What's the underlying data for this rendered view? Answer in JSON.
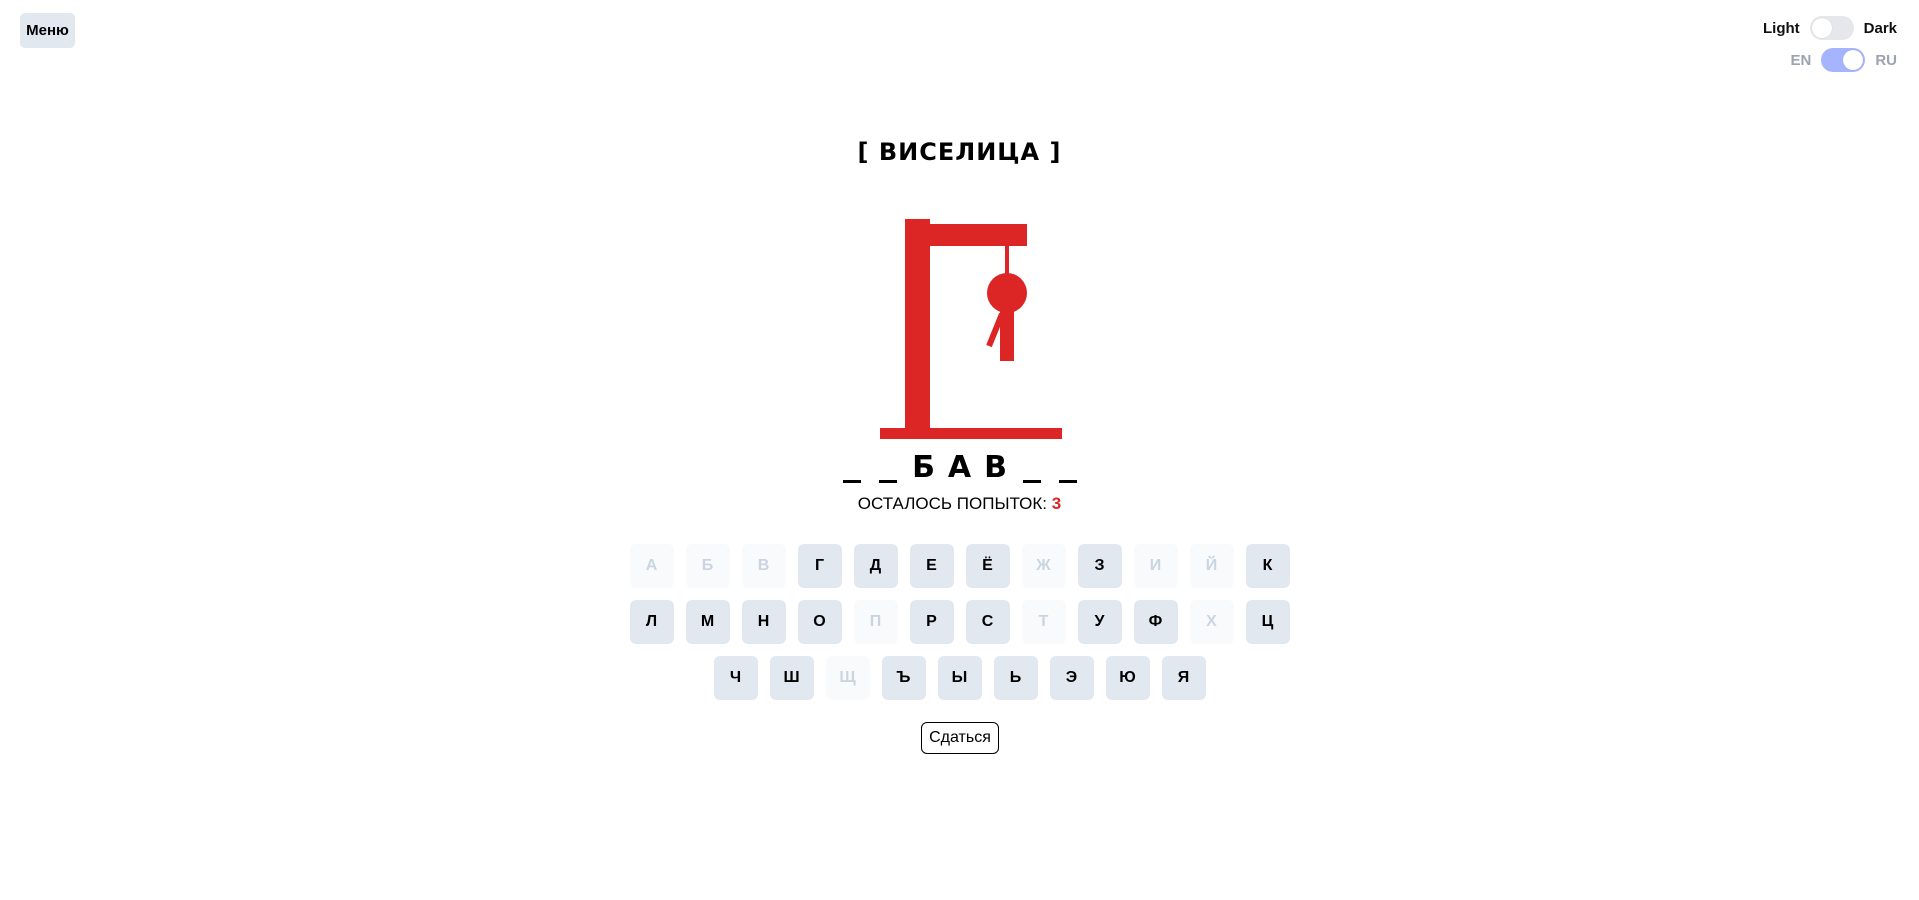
{
  "header": {
    "menu_label": "Меню",
    "theme": {
      "left_label": "Light",
      "right_label": "Dark",
      "enabled": false
    },
    "language": {
      "left_label": "EN",
      "right_label": "RU",
      "enabled": true
    }
  },
  "game": {
    "title": "[ ВИСЕЛИЦА ]",
    "word_slots": [
      "",
      "",
      "Б",
      "А",
      "В",
      "",
      ""
    ],
    "attempts_label": "ОСТАЛОСЬ ПОПЫТОК:",
    "attempts_left": "3",
    "give_up_label": "Сдаться"
  },
  "keyboard": {
    "rows": [
      [
        {
          "letter": "А",
          "used": true
        },
        {
          "letter": "Б",
          "used": true
        },
        {
          "letter": "В",
          "used": true
        },
        {
          "letter": "Г",
          "used": false
        },
        {
          "letter": "Д",
          "used": false
        },
        {
          "letter": "Е",
          "used": false
        },
        {
          "letter": "Ё",
          "used": false
        },
        {
          "letter": "Ж",
          "used": true
        },
        {
          "letter": "З",
          "used": false
        },
        {
          "letter": "И",
          "used": true
        },
        {
          "letter": "Й",
          "used": true
        },
        {
          "letter": "К",
          "used": false
        }
      ],
      [
        {
          "letter": "Л",
          "used": false
        },
        {
          "letter": "М",
          "used": false
        },
        {
          "letter": "Н",
          "used": false
        },
        {
          "letter": "О",
          "used": false
        },
        {
          "letter": "П",
          "used": true
        },
        {
          "letter": "Р",
          "used": false
        },
        {
          "letter": "С",
          "used": false
        },
        {
          "letter": "Т",
          "used": true
        },
        {
          "letter": "У",
          "used": false
        },
        {
          "letter": "Ф",
          "used": false
        },
        {
          "letter": "Х",
          "used": true
        },
        {
          "letter": "Ц",
          "used": false
        }
      ],
      [
        {
          "letter": "Ч",
          "used": false
        },
        {
          "letter": "Ш",
          "used": false
        },
        {
          "letter": "Щ",
          "used": true
        },
        {
          "letter": "Ъ",
          "used": false
        },
        {
          "letter": "Ы",
          "used": false
        },
        {
          "letter": "Ь",
          "used": false
        },
        {
          "letter": "Э",
          "used": false
        },
        {
          "letter": "Ю",
          "used": false
        },
        {
          "letter": "Я",
          "used": false
        }
      ]
    ]
  },
  "colors": {
    "gallows": "#dc2626",
    "key_bg": "#e2e8f0",
    "key_used_bg": "#f8fafc",
    "key_used_text": "#cbd5e1",
    "toggle_on": "#a5b4fc",
    "attempts_number": "#dc2626"
  }
}
